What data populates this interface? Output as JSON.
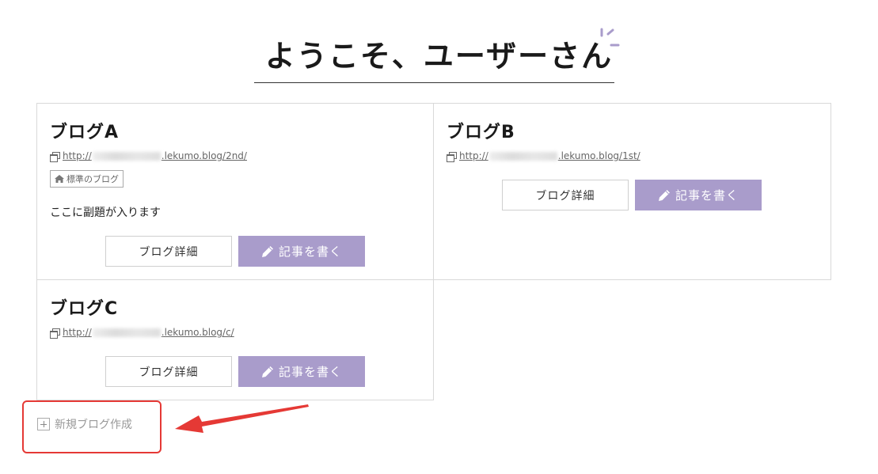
{
  "header": {
    "title": "ようこそ、ユーザーさん"
  },
  "blogs": [
    {
      "name": "ブログA",
      "url_prefix": "http://",
      "url_suffix": ".lekumo.blog/2nd/",
      "badge": "標準のブログ",
      "subtitle": "ここに副題が入ります",
      "detail_label": "ブログ詳細",
      "write_label": "記事を書く"
    },
    {
      "name": "ブログB",
      "url_prefix": "http://",
      "url_suffix": ".lekumo.blog/1st/",
      "detail_label": "ブログ詳細",
      "write_label": "記事を書く"
    },
    {
      "name": "ブログC",
      "url_prefix": "http://",
      "url_suffix": ".lekumo.blog/c/",
      "detail_label": "ブログ詳細",
      "write_label": "記事を書く"
    }
  ],
  "actions": {
    "new_blog_label": "新規ブログ作成"
  },
  "colors": {
    "accent": "#a99ccb",
    "annotation": "#e53935"
  },
  "icons": {
    "url": "window-icon",
    "badge": "home-icon",
    "write": "pencil-icon",
    "new": "plus-icon"
  }
}
